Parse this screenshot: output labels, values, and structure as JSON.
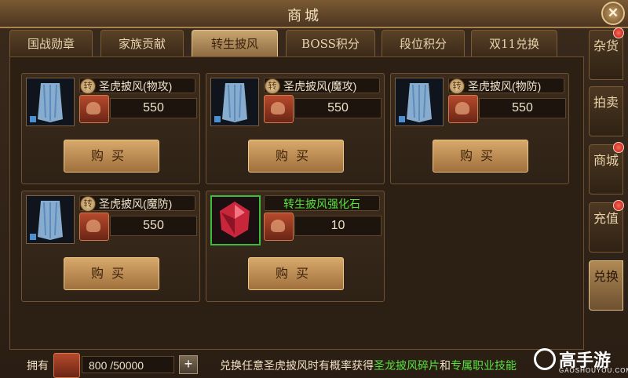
{
  "window": {
    "title": "商城",
    "close_icon": "close-icon"
  },
  "tabs": [
    {
      "label": "国战勋章",
      "active": false
    },
    {
      "label": "家族贡献",
      "active": false
    },
    {
      "label": "转生披风",
      "active": true
    },
    {
      "label": "BOSS积分",
      "active": false
    },
    {
      "label": "段位积分",
      "active": false
    },
    {
      "label": "双11兑换",
      "active": false
    }
  ],
  "items": [
    {
      "badge": "转",
      "name": "圣虎披风(物攻)",
      "price": "550",
      "buy_label": "购买"
    },
    {
      "badge": "转",
      "name": "圣虎披风(魔攻)",
      "price": "550",
      "buy_label": "购买"
    },
    {
      "badge": "转",
      "name": "圣虎披风(物防)",
      "price": "550",
      "buy_label": "购买"
    },
    {
      "badge": "转",
      "name": "圣虎披风(魔防)",
      "price": "550",
      "buy_label": "购买"
    },
    {
      "badge": "",
      "name": "转生披风强化石",
      "price": "10",
      "buy_label": "购买",
      "name_color": "#56e23f"
    }
  ],
  "side_tabs": [
    {
      "label": "杂货",
      "red_dot": true,
      "active": false
    },
    {
      "label": "拍卖",
      "red_dot": false,
      "active": false
    },
    {
      "label": "商城",
      "red_dot": true,
      "active": false
    },
    {
      "label": "充值",
      "red_dot": true,
      "active": false
    },
    {
      "label": "兑换",
      "red_dot": false,
      "active": true
    }
  ],
  "footer": {
    "own_label": "拥有",
    "own_value": "800 /50000",
    "plus_icon": "plus-icon",
    "hint_prefix": "兑换任意圣虎披风时有概率获得",
    "hint_green1": "圣龙披风碎片",
    "hint_mid": "和",
    "hint_green2": "专属职业技能"
  },
  "brand": {
    "name": "高手游",
    "url": "GAOSHOUYOU.COM"
  },
  "colors": {
    "accent_green": "#56e23f",
    "notify_red": "#d7261a",
    "active_tab": "#c9a56f"
  }
}
